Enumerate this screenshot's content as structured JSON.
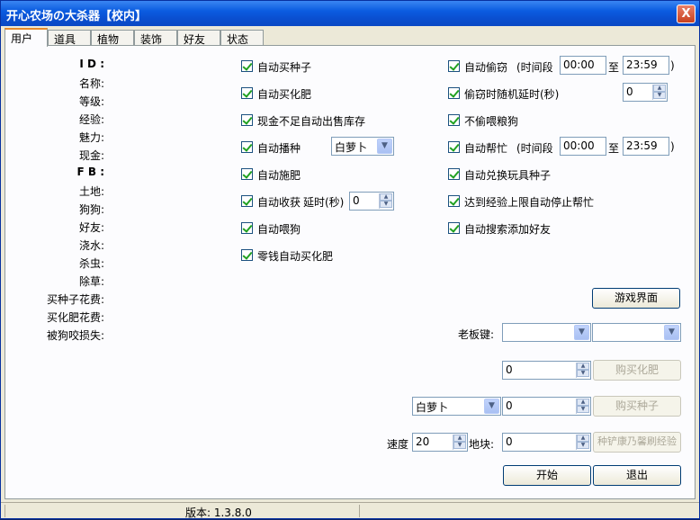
{
  "window": {
    "title": "开心农场の大杀器【校内】",
    "close": "X"
  },
  "tabs": [
    "用户",
    "道具",
    "植物",
    "装饰",
    "好友",
    "状态"
  ],
  "user_info": {
    "labels": [
      "I D :",
      "名称:",
      "等级:",
      "经验:",
      "魅力:",
      "现金:",
      "F B :",
      "土地:",
      "狗狗:",
      "好友:",
      "浇水:",
      "杀虫:",
      "除草:",
      "买种子花费:",
      "买化肥花费:",
      "被狗咬损失:"
    ]
  },
  "options_left": {
    "buy_seed": "自动买种子",
    "buy_fertilizer": "自动买化肥",
    "sell_when_low": "现金不足自动出售库存",
    "auto_sow": "自动播种",
    "sow_seed": "白萝卜",
    "auto_fertilize": "自动施肥",
    "auto_harvest": "自动收获",
    "harvest_delay_label": "延时(秒)",
    "harvest_delay": "0",
    "feed_dog": "自动喂狗",
    "small_change_fertilizer": "零钱自动买化肥"
  },
  "options_right": {
    "auto_steal": "自动偷窃",
    "period_label": "(时间段",
    "steal_from": "00:00",
    "to_label": "至",
    "steal_to": "23:59",
    "close_paren": ")",
    "steal_random_delay": "偷窃时随机延时(秒)",
    "steal_delay": "0",
    "no_steal_dogfood": "不偷喂粮狗",
    "auto_help": "自动帮忙",
    "help_from": "00:00",
    "help_to": "23:59",
    "exchange_toy_seed": "自动兑换玩具种子",
    "stop_help_exp": "达到经验上限自动停止帮忙",
    "auto_add_friend": "自动搜索添加好友"
  },
  "actions": {
    "game_ui": "游戏界面",
    "boss_key_label": "老板键:",
    "fertilizer_qty": "0",
    "buy_fertilizer_btn": "购买化肥",
    "seed_select": "白萝卜",
    "seed_qty": "0",
    "buy_seed_btn": "购买种子",
    "speed_label": "速度",
    "speed": "20",
    "plot_label": "地块:",
    "plot": "0",
    "exp_btn": "种铲康乃馨刷经验",
    "start": "开始",
    "exit": "退出"
  },
  "status": {
    "version": "版本: 1.3.8.0"
  }
}
